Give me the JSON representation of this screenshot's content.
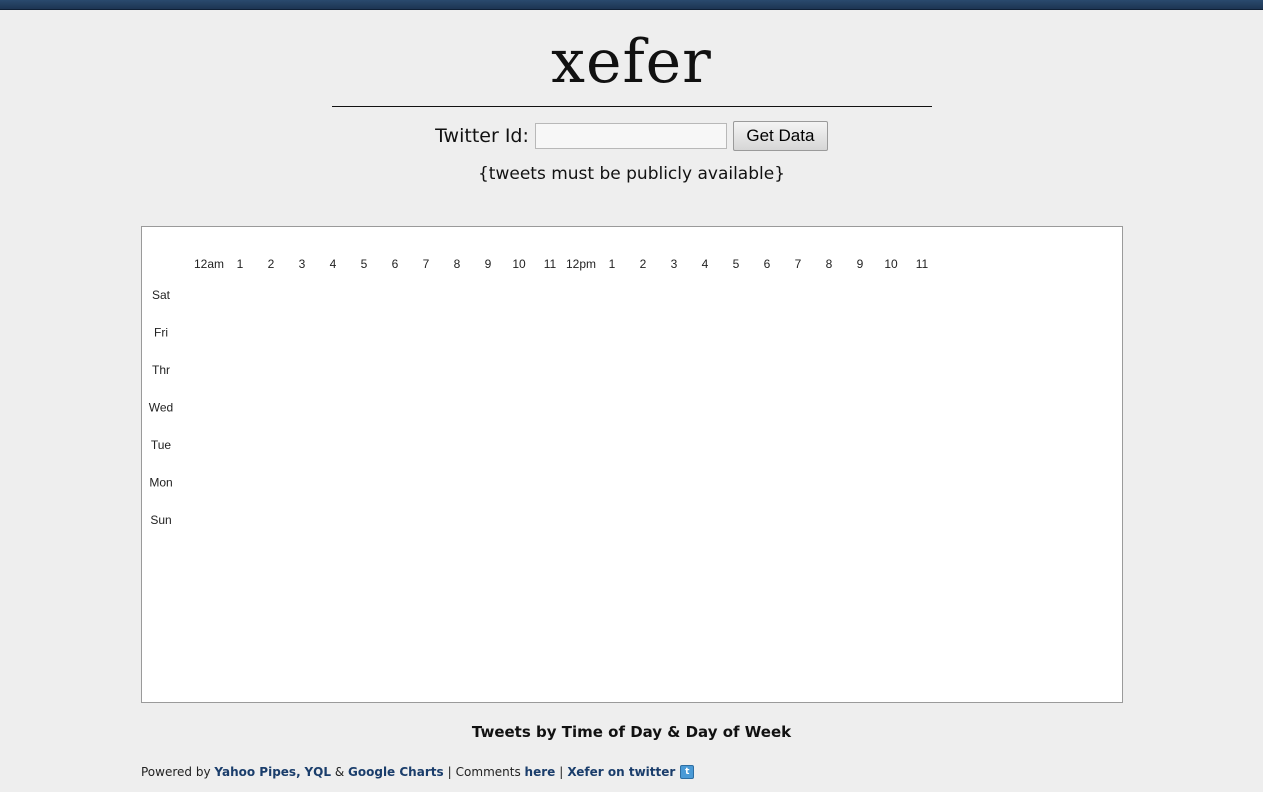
{
  "header": {
    "logo": "xefer"
  },
  "form": {
    "label": "Twitter Id:",
    "input_value": "",
    "input_placeholder": "",
    "button_label": "Get Data"
  },
  "note": "{tweets must be publicly available}",
  "chart_data": {
    "type": "heatmap",
    "x_categories": [
      "12am",
      "1",
      "2",
      "3",
      "4",
      "5",
      "6",
      "7",
      "8",
      "9",
      "10",
      "11",
      "12pm",
      "1",
      "2",
      "3",
      "4",
      "5",
      "6",
      "7",
      "8",
      "9",
      "10",
      "11"
    ],
    "y_categories": [
      "Sat",
      "Fri",
      "Thr",
      "Wed",
      "Tue",
      "Mon",
      "Sun"
    ],
    "values": [],
    "caption": "Tweets by Time of Day & Day of Week"
  },
  "footer": {
    "powered_by": "Powered by",
    "link_pipes": "Yahoo Pipes,",
    "link_yql": "YQL",
    "amp": "&",
    "link_charts": "Google Charts",
    "comments": "Comments",
    "link_here": "here",
    "link_twitter": "Xefer on twitter",
    "twitter_icon": "twitter-bird-icon"
  },
  "colors": {
    "link": "#1a3d6b",
    "topbar": "#2a4a6e",
    "background": "#eeeeee"
  }
}
